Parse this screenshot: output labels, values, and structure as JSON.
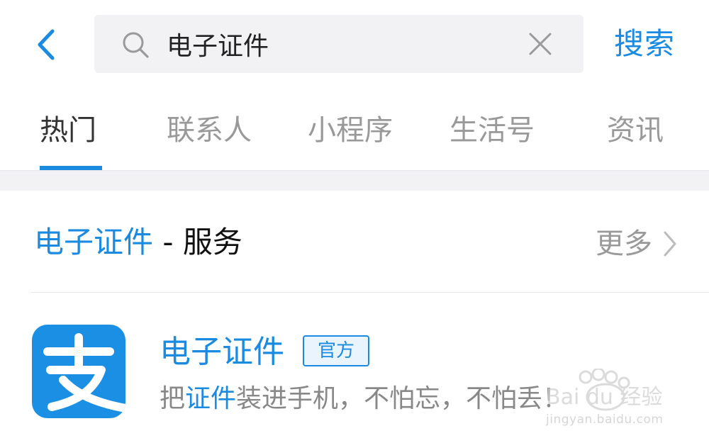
{
  "search": {
    "query": "电子证件",
    "submit_label": "搜索"
  },
  "tabs": [
    {
      "label": "热门",
      "active": true
    },
    {
      "label": "联系人",
      "active": false
    },
    {
      "label": "小程序",
      "active": false
    },
    {
      "label": "生活号",
      "active": false
    },
    {
      "label": "资讯",
      "active": false
    }
  ],
  "section": {
    "keyword": "电子证件",
    "suffix": " - 服务",
    "more_label": "更多"
  },
  "result": {
    "title": "电子证件",
    "badge": "官方",
    "desc_prefix": "把",
    "desc_keyword": "证件",
    "desc_suffix": "装进手机，不怕忘，不怕丢！",
    "logo_glyph": "支"
  },
  "watermark": {
    "brand": "Bai du 经验",
    "url": "jingyan.baidu.com"
  },
  "colors": {
    "accent": "#1a8be0",
    "logo_bg": "#1a8fe3",
    "muted_text": "#999999",
    "search_bg": "#f2f2f4"
  },
  "icons": {
    "back": "chevron-left-icon",
    "search": "search-icon",
    "clear": "close-icon",
    "more": "chevron-right-icon"
  }
}
